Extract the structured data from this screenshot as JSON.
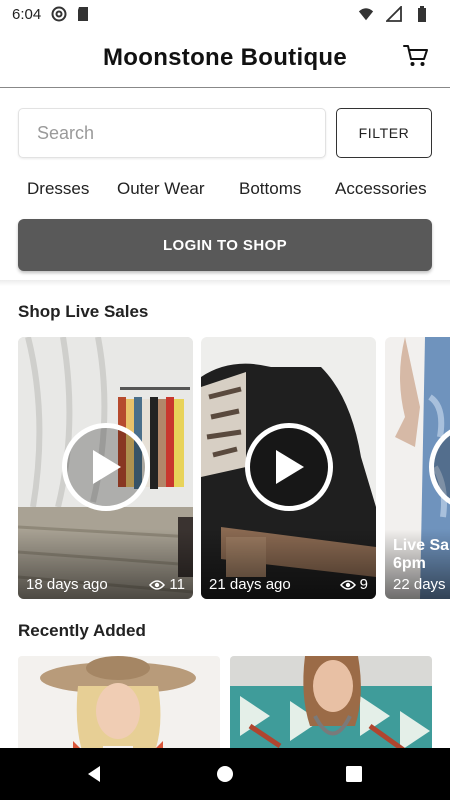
{
  "status_bar": {
    "time": "6:04",
    "icons": [
      "at-sign-icon",
      "sd-card-icon",
      "wifi-icon",
      "signal-icon",
      "battery-icon"
    ]
  },
  "header": {
    "title": "Moonstone Boutique",
    "cart_icon": "cart-icon"
  },
  "search": {
    "placeholder": "Search",
    "value": "",
    "filter_label": "FILTER"
  },
  "categories": [
    "Dresses",
    "Outer Wear",
    "Bottoms",
    "Accessories"
  ],
  "login": {
    "label": "LOGIN TO SHOP"
  },
  "live_sales": {
    "title": "Shop Live Sales",
    "items": [
      {
        "date": "18 days ago",
        "views": "11",
        "overlay": ""
      },
      {
        "date": "21 days ago",
        "views": "9",
        "overlay": ""
      },
      {
        "date": "22 days",
        "views": "",
        "overlay": "Live Sa 6pm"
      }
    ]
  },
  "recently_added": {
    "title": "Recently Added"
  },
  "nav": {
    "icons": [
      "back-icon",
      "home-icon",
      "recents-icon"
    ]
  },
  "colors": {
    "login_button": "#595959",
    "divider": "#888888",
    "nav_bar": "#000000"
  }
}
